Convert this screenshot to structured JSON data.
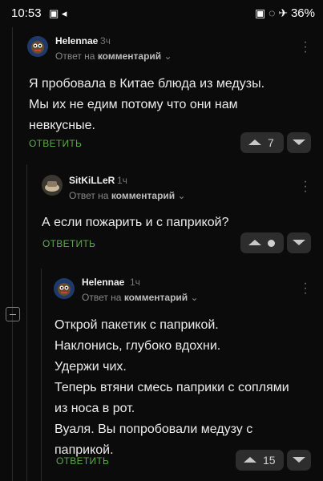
{
  "status_bar": {
    "time": "10:53",
    "battery": "36%",
    "left_icons": "▣ ◂",
    "right_icons": "▣ ◌ ✈"
  },
  "comments": [
    {
      "author": "Helennae",
      "age": "3ч",
      "reply_prefix": "Ответ на",
      "reply_target": "комментарий",
      "body": [
        "Я пробовала в Китае блюда из медузы.",
        "Мы их не едим потому что они нам",
        "невкусные."
      ],
      "reply_label": "ОТВЕТИТЬ",
      "score": "7"
    },
    {
      "author": "SitKiLLeR",
      "age": "1ч",
      "reply_prefix": "Ответ на",
      "reply_target": "комментарий",
      "body": [
        "А если пожарить и с паприкой?"
      ],
      "reply_label": "ОТВЕТИТЬ",
      "score": ""
    },
    {
      "author": "Helennae",
      "age": "1ч",
      "reply_prefix": "Ответ на",
      "reply_target": "комментарий",
      "body": [
        "Открой пакетик с паприкой.",
        "Наклонись, глубоко вдохни.",
        "Удержи чих.",
        "Теперь втяни смесь паприки с соплями",
        "из носа в рот.",
        "Вуаля. Вы попробовали медузу с",
        "паприкой."
      ],
      "reply_label": "ОТВЕТИТЬ",
      "score": "15"
    }
  ],
  "colors": {
    "background": "#0b0b0b",
    "accent_green": "#5fa84a",
    "vote_bg": "#2d2d2d"
  },
  "icons": [
    "chevron-down-icon",
    "more-vertical-icon",
    "upvote-icon",
    "downvote-icon",
    "collapse-icon"
  ]
}
